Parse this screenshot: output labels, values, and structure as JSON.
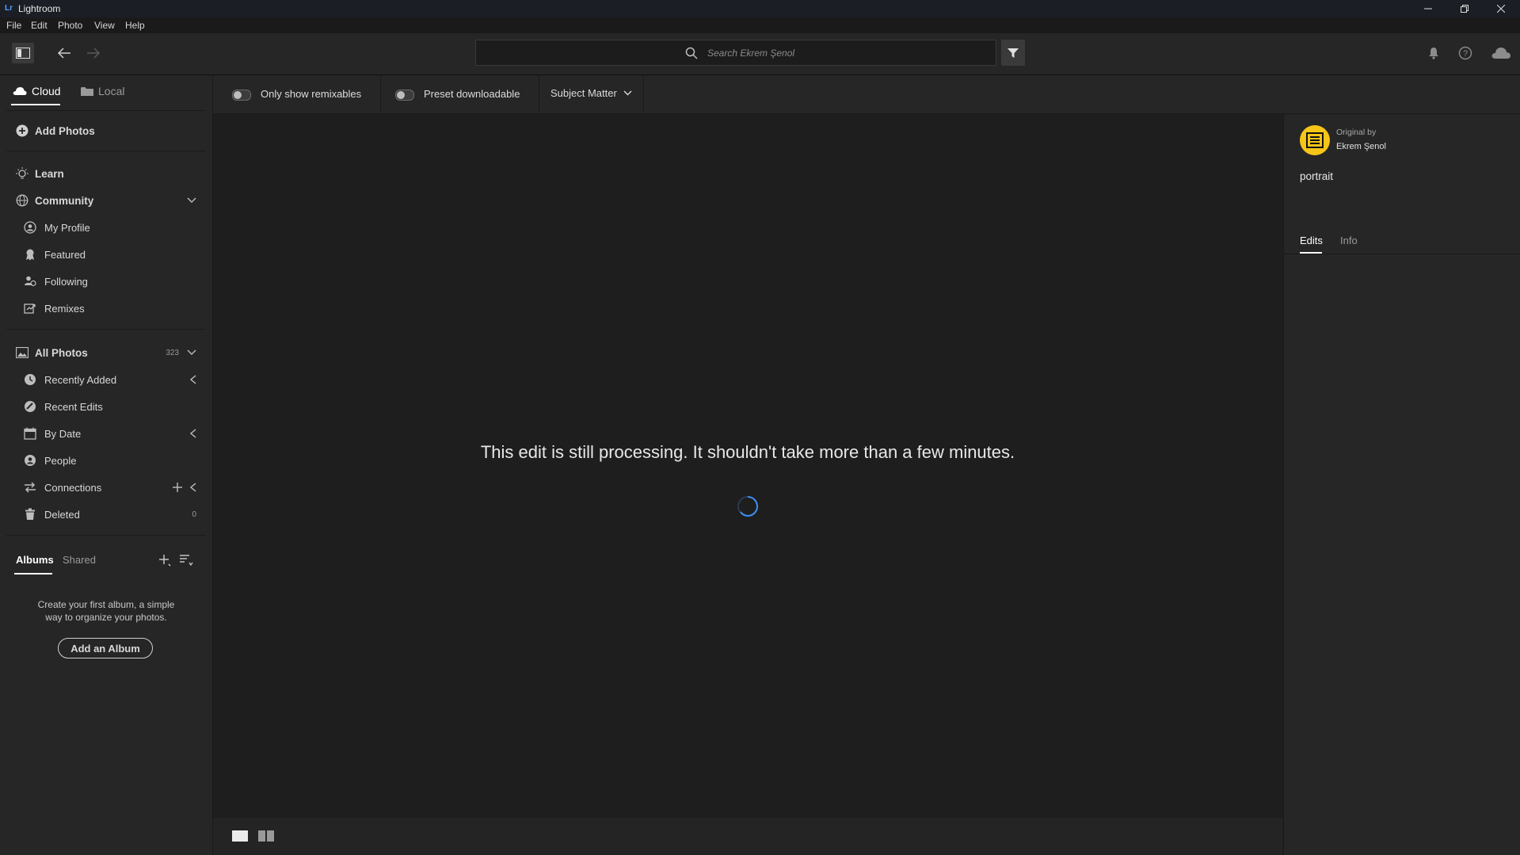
{
  "window": {
    "logo": "Lr",
    "title": "Lightroom"
  },
  "menu": [
    "File",
    "Edit",
    "Photo",
    "View",
    "Help"
  ],
  "search": {
    "placeholder": "Search Ekrem Şenol"
  },
  "sidebar": {
    "tabs": {
      "cloud": "Cloud",
      "local": "Local"
    },
    "add_photos": "Add Photos",
    "learn": "Learn",
    "community": "Community",
    "community_items": [
      "My Profile",
      "Featured",
      "Following",
      "Remixes"
    ],
    "all_photos": {
      "label": "All Photos",
      "count": "323"
    },
    "photo_items": [
      "Recently Added",
      "Recent Edits",
      "By Date",
      "People",
      "Connections",
      "Deleted"
    ],
    "deleted_count": "0",
    "albums_tabs": {
      "albums": "Albums",
      "shared": "Shared"
    },
    "albums_empty": [
      "Create your first album, a simple",
      "way to organize your photos."
    ],
    "add_album": "Add an Album"
  },
  "filters": {
    "remixables": "Only show remixables",
    "preset": "Preset downloadable",
    "subject": "Subject Matter"
  },
  "main": {
    "message": "This edit is still processing. It shouldn't take more than a few minutes."
  },
  "right_panel": {
    "original_by": "Original by",
    "author": "Ekrem Şenol",
    "title": "portrait",
    "tabs": {
      "edits": "Edits",
      "info": "Info"
    }
  },
  "colors": {
    "accent": "#4da3ff",
    "avatar": "#f5c518",
    "background": "#1e1e1e",
    "panel": "#262626"
  }
}
